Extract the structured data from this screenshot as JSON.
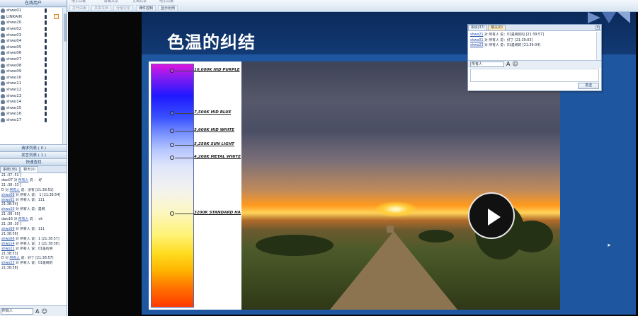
{
  "left_panel": {
    "title": "在线用户",
    "users": [
      "shwo01",
      "LINKAIN",
      "shwo20",
      "shwo02",
      "shwo03",
      "shwo04",
      "shwo05",
      "shwo06",
      "shwo07",
      "shwo08",
      "shwo09",
      "shwo10",
      "shwo11",
      "shwo12",
      "shwo13",
      "shwo14",
      "shwo15",
      "shwo16",
      "shwo17"
    ],
    "request_list": "请求列表 ( 0 )",
    "speak_list": "发言列表 ( 1 )",
    "quick_search": "快速查找",
    "chat_tabs": [
      "系统(36)",
      "聊天(0)"
    ],
    "messages": [
      {
        "pre": "21 :37 :51 ]",
        "link": "",
        "post": ""
      },
      {
        "pre": "dwo07 对 ",
        "link": "所有人",
        "post": " 说 ： 好"
      },
      {
        "pre": "21 :38 :33 ]",
        "link": "",
        "post": ""
      },
      {
        "pre": "D 对 ",
        "link": "所有人",
        "post": " 说：没有 [21:38:51]"
      },
      {
        "pre": "",
        "link": "shwo08",
        "post": " 对 所有人 说： 1 [21:38:54]"
      },
      {
        "pre": "",
        "link": "shwo02",
        "post": " 对 所有人 说：111"
      },
      {
        "pre": "21:38:54]",
        "link": "",
        "post": ""
      },
      {
        "pre": "",
        "link": "shwo20",
        "post": " 对 所有人 说：是啊"
      },
      {
        "pre": "21 :38 :55]",
        "link": "",
        "post": ""
      },
      {
        "pre": "dwo16 对 ",
        "link": "所有人",
        "post": " 说 ： ok"
      },
      {
        "pre": "21 :38 :30 ]",
        "link": "",
        "post": ""
      },
      {
        "pre": "",
        "link": "shwo09",
        "post": " 对 所有人 说：111"
      },
      {
        "pre": "21:38:56]",
        "link": "",
        "post": ""
      },
      {
        "pre": "",
        "link": "shwo06",
        "post": " 对 所有人 说：1 [21:38:57]"
      },
      {
        "pre": "",
        "link": "shwo14",
        "post": " 对 所有人 说：1 [21:38:58]"
      },
      {
        "pre": "",
        "link": "shwo21",
        "post": " 对 所有人 说：01是的吧"
      },
      {
        "pre": "21:38:53]",
        "link": "",
        "post": ""
      },
      {
        "pre": "D 对 ",
        "link": "所有人",
        "post": " 说：好了 [21:38:57]"
      },
      {
        "pre": "",
        "link": "shwo23",
        "post": " 对 所有人 说：01是啊的"
      },
      {
        "pre": "21:38:58]",
        "link": "",
        "post": ""
      }
    ],
    "recipient": "所有人",
    "font_icon": "A",
    "emoji_icon": "☺"
  },
  "toolbar": {
    "top_labels": [
      "电子白板",
      "屏幕共享",
      "文档共享",
      "电子白板"
    ],
    "buttons": [
      "打开白板",
      "共享文档",
      "分组讨论",
      "课件控制",
      "显示比例"
    ]
  },
  "video": {
    "slide_title": "色温的纠结",
    "color_temps": [
      "10,000K HID PURPLE",
      "7,500K HID BLUE",
      "5,600K HID WHITE",
      "5,250K SUN LIGHT",
      "4,200K METAL WHITE",
      "3200K STANDARD HA"
    ],
    "play_icon": "play-icon"
  },
  "floating_chat": {
    "tabs": [
      "系统(37)",
      "聊天(0)"
    ],
    "messages": [
      {
        "link": "shwo21",
        "post": " 对 所有人 说：01是啊的吗 [21:39:57]"
      },
      {
        "link": "shwo01",
        "post": " 对 所有人 说：好了 [21:39:03]"
      },
      {
        "link": "shwo23",
        "post": " 对 所有人 说：01是啊的 [21:39:04]"
      }
    ],
    "recipient": "所有人",
    "font_icon": "A",
    "emoji_icon": "☺",
    "send": "发送"
  }
}
